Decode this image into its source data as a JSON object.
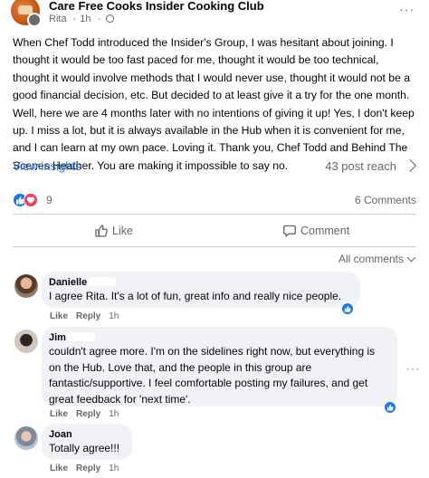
{
  "header": {
    "group_name": "Care Free Cooks Insider Cooking Club",
    "author": "Rita",
    "time": "1h",
    "separator": "·",
    "more": "···"
  },
  "post": {
    "text": "When Chef Todd introduced the  Insider's Group, I was hesitant about joining. I thought it would be too fast paced for me, thought it would be too technical, thought it would involve methods that I would never use, thought it would not be a good financial decision, etc. But decided to at least give it a try for the one month. Well, here we are 4 months later with no intentions of giving it up! Yes, I don't keep up. I miss a lot, but it is always available in the Hub when it is convenient for me, and I can learn at my own pace. Loving it. Thank you, Chef Todd and Behind The Scenes Heather. You are making it impossible to say no."
  },
  "insights": {
    "view_insights": "View insights",
    "post_reach": "43 post reach"
  },
  "reactions": {
    "count": "9",
    "comments": "6 Comments",
    "icons": [
      "like-icon",
      "love-icon"
    ],
    "like_color": "#1877f2",
    "love_color": "#f33e58"
  },
  "actions": {
    "like": "Like",
    "comment": "Comment"
  },
  "sort": {
    "label": "All comments"
  },
  "comments": [
    {
      "name": "Danielle",
      "text": "I agree Rita. It's a lot of fun, great info and really nice people.",
      "like": "Like",
      "reply": "Reply",
      "time": "1h"
    },
    {
      "name": "Jim",
      "text": "couldn't agree more. I'm on the sidelines right now, but everything is on the Hub. Love that, and the people in this group are fantastic/supportive. I feel comfortable posting my failures, and get great feedback for 'next time'.",
      "like": "Like",
      "reply": "Reply",
      "time": "1h",
      "more": "···"
    },
    {
      "name": "Joan",
      "text": "Totally agree!!!",
      "like": "Like",
      "reply": "Reply",
      "time": "1h"
    }
  ],
  "colors": {
    "accent": "#216fdb",
    "secondary_text": "#65676b",
    "bubble": "#f0f2f5"
  }
}
